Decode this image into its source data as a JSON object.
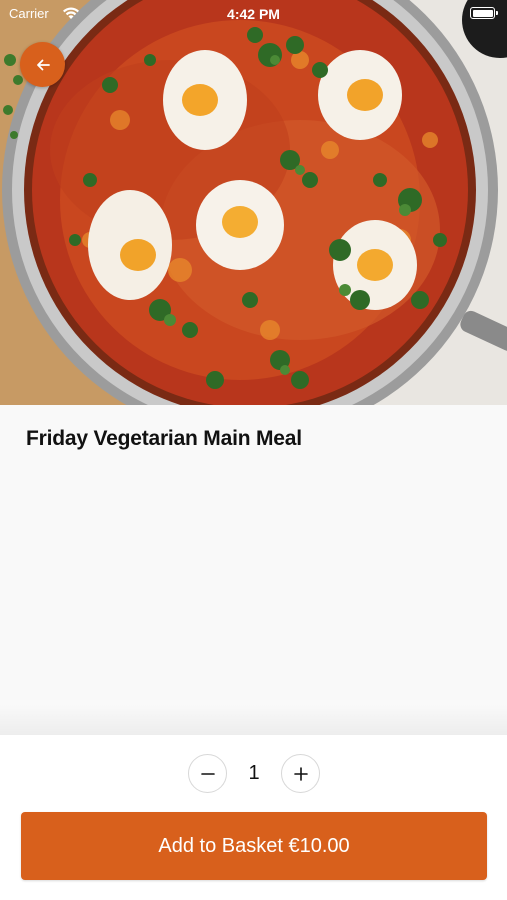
{
  "status_bar": {
    "carrier": "Carrier",
    "time": "4:42 PM"
  },
  "hero": {
    "image_description_icon": "food-photo"
  },
  "back_button": {
    "icon": "arrow-left-icon"
  },
  "meal": {
    "title": "Friday Vegetarian Main Meal"
  },
  "quantity": {
    "value": "1",
    "decrement_icon": "minus-icon",
    "increment_icon": "plus-icon"
  },
  "basket": {
    "label": "Add to Basket €10.00"
  },
  "colors": {
    "accent": "#d8601c",
    "background": "#f9f9f9",
    "panel": "#ffffff",
    "text": "#111111"
  }
}
